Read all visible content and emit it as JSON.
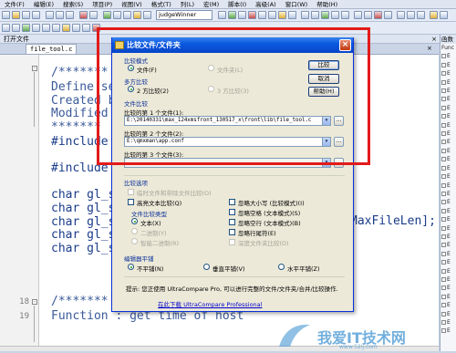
{
  "menubar": {
    "items": [
      "文件(F)",
      "编辑(E)",
      "搜索(S)",
      "项目(P)",
      "视图(V)",
      "格式(T)",
      "列(L)",
      "宏(M)",
      "脚本(I)",
      "高级(A)",
      "窗口(W)",
      "帮助(H)"
    ]
  },
  "toolbar": {
    "combo_text": "judgeWinner"
  },
  "pane": {
    "title": "打开文件",
    "close": "×"
  },
  "tab": {
    "filename": "file_tool.c",
    "close": "×"
  },
  "right_panel": {
    "title": "函数",
    "root": "Func",
    "items": [
      "E",
      "E",
      "E",
      "E",
      "E",
      "E",
      "E",
      "E",
      "E",
      "E",
      "E",
      "E",
      "E",
      "E",
      "E",
      "E",
      "E",
      "E",
      "E",
      "E",
      "E",
      "E",
      "E",
      "E",
      "E",
      "E",
      "E",
      "E",
      "E",
      "E",
      "E",
      "E",
      "E"
    ]
  },
  "editor": {
    "line_numbers": [
      "18",
      "19"
    ],
    "code_lines": [
      "/*******",
      "Define se",
      "Created b",
      "Modified",
      "*******",
      "#include",
      "#include",
      "char gl_s",
      "char gl_s",
      "char gl_s",
      "char gl_s",
      "char gl_s",
      "/*******",
      "Function : get time of host"
    ],
    "code_fragment": "MaxFileLen];"
  },
  "dialog": {
    "title": "比较文件/文件夹",
    "close": "×",
    "mode_section": "比较模式",
    "mode_file": "文件(F)",
    "mode_folder": "文件夹(L)",
    "multi_section": "多方比较",
    "two_way": "2 方比较(2)",
    "three_way": "3 方比较(3)",
    "files_section": "文件比较",
    "file1_label": "比较的第 1 个文件(1):",
    "file1_value": "E:\\20140331\\max_124xmsfront_130517_x\\front\\lib\\file_tool.c",
    "file2_label": "比较的第 2 个文件(2):",
    "file2_value": "E:\\qmxman\\app.conf",
    "file3_label": "比较的第 3 个文件(3):",
    "file3_value": "",
    "browse": "...",
    "buttons": {
      "compare": "比较",
      "cancel": "取消",
      "help": "帮助(H)"
    },
    "options_section": "比较选项",
    "opt_ignore_line_end": "临时文件和带除文件比较(O)",
    "opt_fast": "高亮文本比较(Q)",
    "opt_ignore_case": "忽略大小写 (比较模式)(I)",
    "opt_ignore_space": "忽略空格 (文本模式)(S)",
    "opt_ignore_blank": "忽略空行 (文本模式)(B)",
    "opt_ignore_eol": "忽略行尾符(E)",
    "opt_ignore_subfolder": "深度文件夹比较(D)",
    "type_section": "文件比较类型",
    "type_text": "文本(X)",
    "type_binary": "二进制(Y)",
    "type_smart": "智能二进制(R)",
    "tile_section": "编辑器平铺",
    "tile_none": "不平铺(N)",
    "tile_vertical": "垂直平铺(V)",
    "tile_horizontal": "水平平铺(Z)",
    "tip_text": "提示: 您正使用 UltraCompare Pro, 可以进行完整的文件/文件夹/合并/比较操作.",
    "tip_link": "在此下载 UltraCompare Professional"
  },
  "watermark": {
    "text": "我爱IT技术网",
    "sub": "www.52ij.com"
  }
}
